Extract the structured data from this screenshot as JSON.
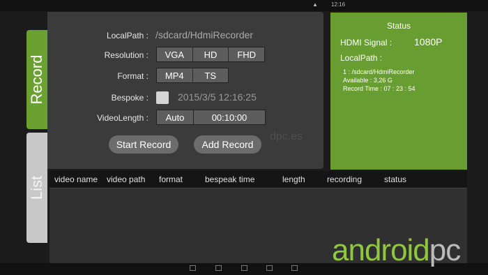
{
  "system_bar": {
    "time": "12:16"
  },
  "tabs": {
    "record": "Record",
    "list": "List"
  },
  "record": {
    "localpath_label": "LocalPath :",
    "localpath_value": "/sdcard/HdmiRecorder",
    "resolution_label": "Resolution :",
    "resolution_options": [
      "VGA",
      "HD",
      "FHD"
    ],
    "format_label": "Format :",
    "format_options": [
      "MP4",
      "TS"
    ],
    "bespoke_label": "Bespoke :",
    "bespoke_checked": false,
    "bespoke_datetime": "2015/3/5 12:16:25",
    "videolength_label": "VideoLength :",
    "videolength_mode": "Auto",
    "videolength_value": "00:10:00",
    "start_button": "Start Record",
    "add_button": "Add Record"
  },
  "status": {
    "title": "Status",
    "hdmi_signal_label": "HDMI Signal :",
    "hdmi_signal_value": "1080P",
    "localpath_label": "LocalPath :",
    "path_line": "1 : /sdcard/HdmiRecorder",
    "available_line": "Available : 3,26 G",
    "record_time_line": "Record Time : 07 : 23 : 54"
  },
  "list": {
    "columns": [
      "video name",
      "video path",
      "format",
      "bespeak time",
      "length",
      "recording",
      "status"
    ],
    "rows": []
  },
  "watermark": {
    "url_fragment": "dpc.es",
    "brand_main": "android",
    "brand_sub": "pc"
  },
  "colors": {
    "accent_green": "#689d31",
    "tab_green": "#6aa131",
    "panel_dark": "#3b3b3b",
    "button_gray": "#5d5d5d"
  }
}
